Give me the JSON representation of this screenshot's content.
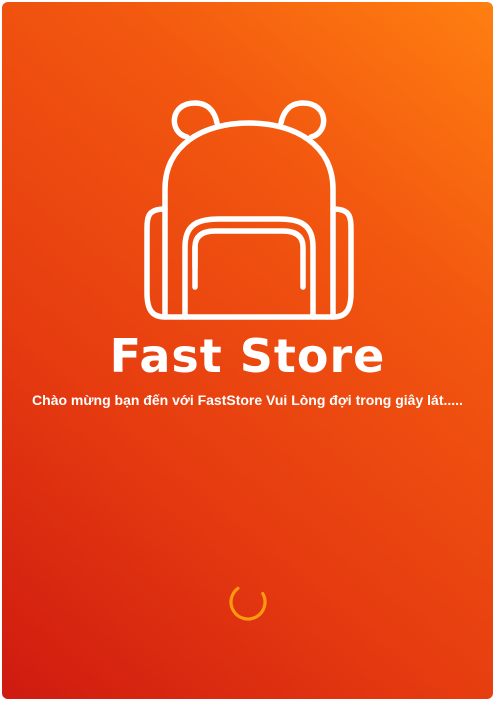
{
  "splash": {
    "brand_name": "Fast Store",
    "welcome_message": "Chào mừng bạn đến với FastStore Vui Lòng đợi trong giây lát.....",
    "logo_icon": "backpack-icon",
    "loading_icon": "spinner-icon"
  },
  "colors": {
    "gradient_top_right": "#ff7f11",
    "gradient_bottom_left": "#cf1a10",
    "spinner": "#ff9a10",
    "text": "#ffffff"
  }
}
